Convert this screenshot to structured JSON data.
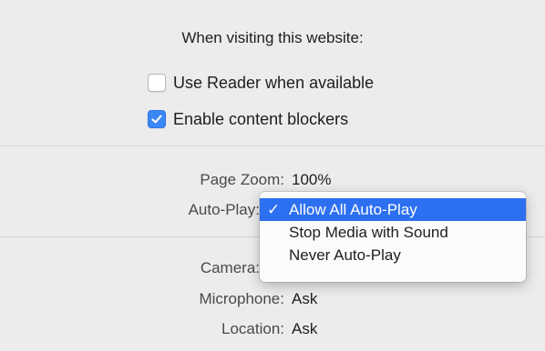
{
  "heading": "When visiting this website:",
  "checkboxes": [
    {
      "label": "Use Reader when available",
      "checked": false
    },
    {
      "label": "Enable content blockers",
      "checked": true
    }
  ],
  "page_zoom": {
    "label": "Page Zoom:",
    "value": "100%"
  },
  "auto_play": {
    "label": "Auto-Play:"
  },
  "camera": {
    "label": "Camera:"
  },
  "microphone": {
    "label": "Microphone:",
    "value": "Ask"
  },
  "location": {
    "label": "Location:",
    "value": "Ask"
  },
  "auto_play_menu": {
    "items": [
      {
        "label": "Allow All Auto-Play",
        "selected": true
      },
      {
        "label": "Stop Media with Sound",
        "selected": false
      },
      {
        "label": "Never Auto-Play",
        "selected": false
      }
    ],
    "check_glyph": "✓"
  },
  "colors": {
    "accent": "#2c6ff0",
    "checkbox_checked": "#3b87f6",
    "background": "#ececec"
  }
}
